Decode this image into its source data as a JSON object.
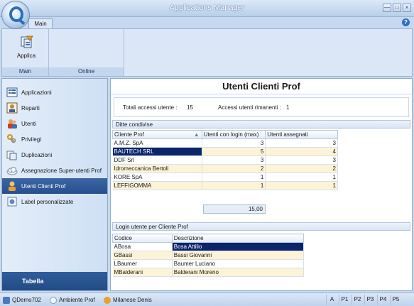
{
  "window": {
    "title": "Applications Manager"
  },
  "ribbon": {
    "tab_main": "Main",
    "groups": [
      {
        "button": "Applica",
        "label": "Main"
      },
      {
        "label": "Online"
      }
    ]
  },
  "sidebar": {
    "items": [
      {
        "label": "Applicazioni",
        "icon": "apps-icon"
      },
      {
        "label": "Reparti",
        "icon": "departments-icon"
      },
      {
        "label": "Utenti",
        "icon": "users-icon"
      },
      {
        "label": "Privilegi",
        "icon": "keys-icon"
      },
      {
        "label": "Duplicazioni",
        "icon": "duplicate-icon"
      },
      {
        "label": "Assegnazione Super-utenti Prof",
        "icon": "cloud-icon"
      },
      {
        "label": "Utenti Clienti Prof",
        "icon": "client-user-icon"
      },
      {
        "label": "Label personalizzate",
        "icon": "label-icon"
      }
    ],
    "bottom_label": "Tabella"
  },
  "content": {
    "title": "Utenti Clienti Prof",
    "totals": {
      "label_total": "Totali accessi utente :",
      "value_total": "15",
      "label_remaining": "Accessi utenti rimanenti :",
      "value_remaining": "1"
    },
    "shared": {
      "header": "Ditte condivise",
      "columns": [
        "Cliente Prof",
        "Utenti con login (max)",
        "Utenti assegnati"
      ],
      "rows": [
        {
          "client": "A.M.Z. SpA",
          "max": "3",
          "assigned": "3"
        },
        {
          "client": "BAUTECH SRL",
          "max": "5",
          "assigned": "4"
        },
        {
          "client": "DDF Srl",
          "max": "3",
          "assigned": "3"
        },
        {
          "client": "Idromeccanica Bertoli",
          "max": "2",
          "assigned": "2"
        },
        {
          "client": "KORE SpA",
          "max": "1",
          "assigned": "1"
        },
        {
          "client": "LEFFIGOMMA",
          "max": "1",
          "assigned": "1"
        }
      ],
      "sum": "15,00"
    },
    "logins": {
      "header": "Login utente per Cliente Prof",
      "columns": [
        "Codice",
        "Descrizione"
      ],
      "rows": [
        {
          "code": "ABosa",
          "desc": "Bosa Attilio"
        },
        {
          "code": "GBassi",
          "desc": "Bassi Giovanni"
        },
        {
          "code": "LBaumer",
          "desc": "Baumer Luciano"
        },
        {
          "code": "MBalderani",
          "desc": "Balderani Moreno"
        }
      ]
    }
  },
  "status": {
    "db": "QDemo702",
    "env": "Ambiente Prof",
    "user": "Milanese Denis",
    "keys": [
      "A",
      "P1",
      "P2",
      "P3",
      "P4",
      "P5"
    ]
  }
}
